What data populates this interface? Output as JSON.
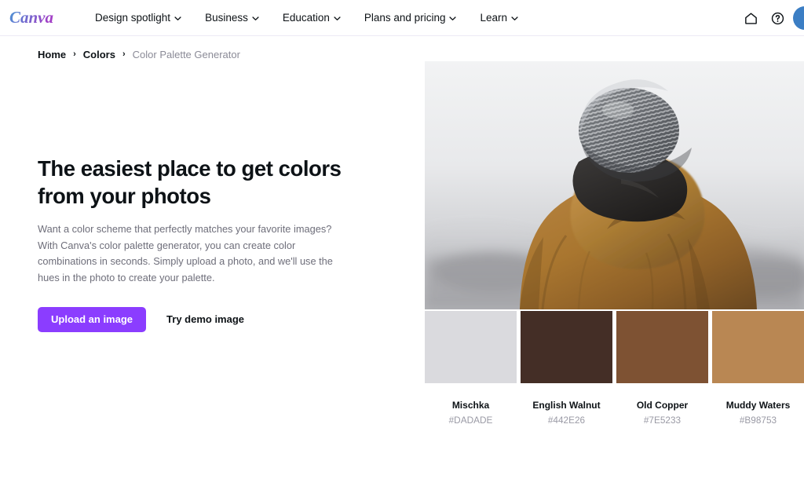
{
  "nav": {
    "logo_text": "Canva",
    "items": [
      {
        "label": "Design spotlight",
        "icon": "chevron-down-icon"
      },
      {
        "label": "Business",
        "icon": "chevron-down-icon"
      },
      {
        "label": "Education",
        "icon": "chevron-down-icon"
      },
      {
        "label": "Plans and pricing",
        "icon": "chevron-down-icon"
      },
      {
        "label": "Learn",
        "icon": "chevron-down-icon"
      }
    ],
    "right_icons": [
      {
        "name": "home-icon"
      },
      {
        "name": "help-icon"
      }
    ]
  },
  "breadcrumb": {
    "items": [
      {
        "label": "Home",
        "current": false
      },
      {
        "label": "Colors",
        "current": false
      },
      {
        "label": "Color Palette Generator",
        "current": true
      }
    ],
    "separator": "›"
  },
  "hero": {
    "headline": "The easiest place to get colors from your photos",
    "description": "Want a color scheme that perfectly matches your favorite images? With Canva's color palette generator, you can create color combinations in seconds. Simply upload a photo, and we'll use the hues in the photo to create your palette.",
    "primary_button": "Upload an image",
    "secondary_button": "Try demo image"
  },
  "preview": {
    "image_alt": "Person seen from behind wearing a gray knit beanie and tan hooded jacket against a misty gray sky",
    "palette": [
      {
        "name": "Mischka",
        "hex": "#DADADE"
      },
      {
        "name": "English Walnut",
        "hex": "#442E26"
      },
      {
        "name": "Old Copper",
        "hex": "#7E5233"
      },
      {
        "name": "Muddy Waters",
        "hex": "#B98753"
      }
    ]
  },
  "colors": {
    "brand_purple": "#8B3DFF",
    "accent_blue": "#3B7EC4",
    "text_primary": "#0D1216",
    "text_muted": "#6E6E7A"
  }
}
